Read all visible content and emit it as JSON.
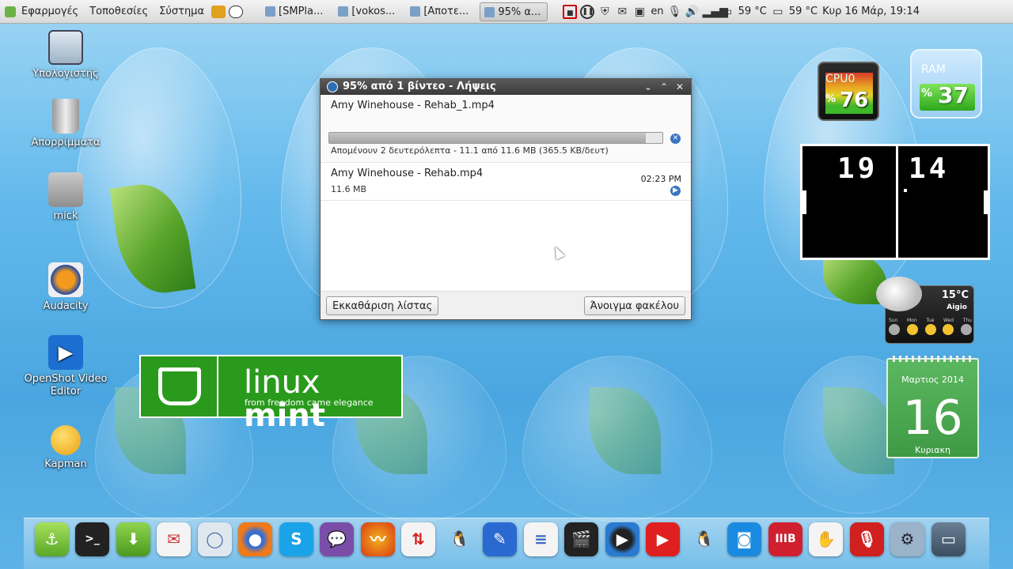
{
  "top_panel": {
    "menus": [
      "Εφαρμογές",
      "Τοποθεσίες",
      "Σύστημα"
    ],
    "tasks": [
      "[SMPla...",
      "[vokos...",
      "[Αποτε...",
      "95% α..."
    ],
    "tray": {
      "keyboard_layout": "en",
      "temp_1": "59 °C",
      "temp_2": "59 °C",
      "clock": "Κυρ 16 Μάρ, 19:14"
    }
  },
  "desktop_icons": [
    {
      "label": "Υπολογιστής",
      "icon": "computer-icon"
    },
    {
      "label": "Απορρίμματα",
      "icon": "trash-icon"
    },
    {
      "label": "mick",
      "icon": "home-folder-icon"
    },
    {
      "label": "Audacity",
      "icon": "audacity-icon"
    },
    {
      "label": "OpenShot Video Editor",
      "icon": "openshot-icon"
    },
    {
      "label": "Kapman",
      "icon": "kapman-icon"
    }
  ],
  "downloads_window": {
    "title": "95% από 1 βίντεο - Λήψεις",
    "items": [
      {
        "name": "Amy Winehouse - Rehab_1.mp4",
        "status": "Απομένουν 2 δευτερόλεπτα - 11.1 από 11.6 MB (365.5 KB/δευτ)",
        "progress": 0.95
      },
      {
        "name": "Amy Winehouse - Rehab.mp4",
        "status": "11.6 MB",
        "time": "02:23 PM"
      }
    ],
    "clear_button": "Εκκαθάριση λίστας",
    "open_folder_button": "Άνοιγμα φακέλου"
  },
  "mint_banner": {
    "brand_light": "linux ",
    "brand_bold": "mint",
    "tagline": "from freedom came elegance"
  },
  "widgets": {
    "cpu": {
      "label": "CPU0",
      "pct_sign": "%",
      "value": "76"
    },
    "ram": {
      "label": "RAM",
      "pct_sign": "%",
      "value": "37"
    },
    "pong": {
      "left_score": "19",
      "right_score": "14"
    },
    "weather": {
      "temp": "15°C",
      "place": "Aigio",
      "days": [
        "Sun",
        "Mon",
        "Tue",
        "Wed",
        "Thu"
      ]
    },
    "calendar": {
      "month": "Μαρτιος 2014",
      "day": "16",
      "weekday": "Κυριακη"
    }
  },
  "colors": {
    "mint_green": "#2a9a1c",
    "calendar_green": "#4aa84f",
    "progress_blue": "#3a76c0"
  }
}
